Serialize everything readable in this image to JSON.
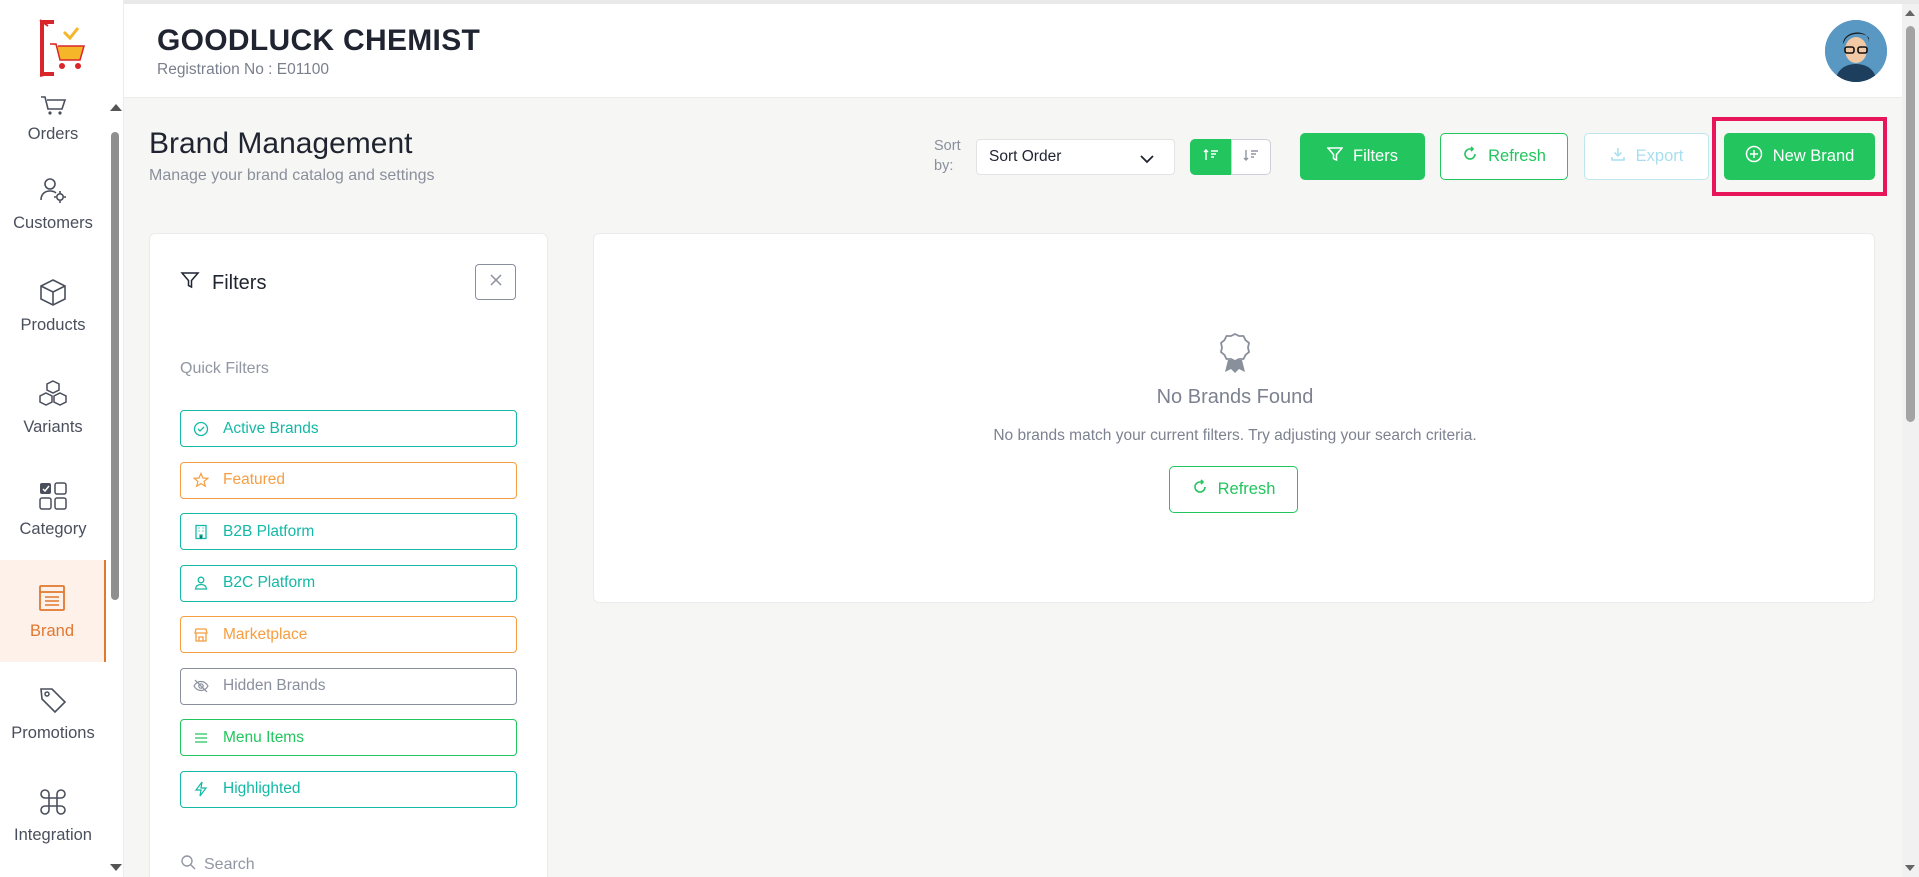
{
  "header": {
    "shop_name": "GOODLUCK CHEMIST",
    "registration": "Registration No : E01100"
  },
  "sidebar": {
    "items": [
      {
        "label": "Orders",
        "icon": "cart-icon"
      },
      {
        "label": "Customers",
        "icon": "user-gear-icon"
      },
      {
        "label": "Products",
        "icon": "box-icon"
      },
      {
        "label": "Variants",
        "icon": "boxes-icon"
      },
      {
        "label": "Category",
        "icon": "grid-icon"
      },
      {
        "label": "Brand",
        "icon": "brand-icon",
        "active": true
      },
      {
        "label": "Promotions",
        "icon": "tag-icon"
      },
      {
        "label": "Integration",
        "icon": "command-icon"
      }
    ]
  },
  "page": {
    "title": "Brand Management",
    "subtitle": "Manage your brand catalog and settings"
  },
  "toolbar": {
    "sort_label": "Sort by:",
    "sort_value": "Sort Order",
    "filters_label": "Filters",
    "refresh_label": "Refresh",
    "export_label": "Export",
    "new_brand_label": "New Brand"
  },
  "filter_panel": {
    "title": "Filters",
    "quick_filters_label": "Quick Filters",
    "chips": [
      {
        "label": "Active Brands",
        "icon": "check-circle-icon",
        "color": "#14b8a6"
      },
      {
        "label": "Featured",
        "icon": "star-icon",
        "color": "#f59e42"
      },
      {
        "label": "B2B Platform",
        "icon": "building-icon",
        "color": "#14b8a6"
      },
      {
        "label": "B2C Platform",
        "icon": "user-icon",
        "color": "#14b8a6"
      },
      {
        "label": "Marketplace",
        "icon": "store-icon",
        "color": "#f59e42"
      },
      {
        "label": "Hidden Brands",
        "icon": "eye-off-icon",
        "color": "#8a8f9c"
      },
      {
        "label": "Menu Items",
        "icon": "menu-icon",
        "color": "#22c55e"
      },
      {
        "label": "Highlighted",
        "icon": "bolt-icon",
        "color": "#14b8a6"
      }
    ],
    "search_label": "Search"
  },
  "empty_state": {
    "title": "No Brands Found",
    "message": "No brands match your current filters. Try adjusting your search criteria.",
    "refresh_label": "Refresh"
  },
  "colors": {
    "primary": "#22c55e",
    "active_nav": "#e0782f",
    "highlight": "#e8155b"
  }
}
